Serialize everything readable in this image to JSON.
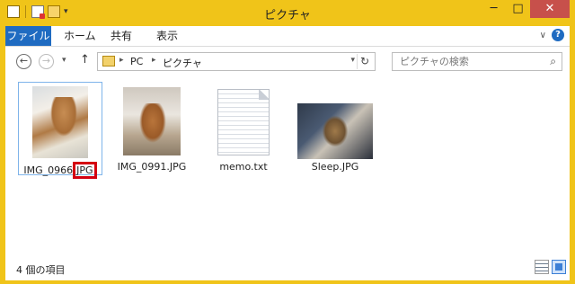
{
  "window": {
    "title": "ピクチャ",
    "controls": {
      "minimize": "─",
      "maximize": "□",
      "close": "✕"
    }
  },
  "quick_access": {
    "icons": [
      "folder-icon",
      "properties-icon",
      "new-folder-icon"
    ],
    "dropdown": "▾"
  },
  "ribbon": {
    "tabs": [
      {
        "label": "ファイル",
        "active": true
      },
      {
        "label": "ホーム"
      },
      {
        "label": "共有"
      },
      {
        "label": "表示"
      }
    ],
    "expand": "∨",
    "help": "?"
  },
  "navigation": {
    "back": "←",
    "forward": "→",
    "recent": "▾",
    "up": "↑",
    "breadcrumb": [
      "PC",
      "ピクチャ"
    ],
    "separator": "▸",
    "address_dropdown": "▾",
    "refresh": "↻",
    "search_placeholder": "ピクチャの検索",
    "search_icon": "⌕"
  },
  "files": [
    {
      "name_part1": "IMG_0966",
      "name_part2": "JPG",
      "type": "image",
      "selected": true,
      "highlighted_extension": true
    },
    {
      "name": "IMG_0991.JPG",
      "type": "image"
    },
    {
      "name": "memo.txt",
      "type": "text"
    },
    {
      "name": "Sleep.JPG",
      "type": "image"
    }
  ],
  "status": {
    "item_count": "4 個の項目"
  },
  "colors": {
    "title_bar": "#f0c419",
    "file_tab": "#1f6bc1",
    "selection_border": "#7eb4ea",
    "highlight_box": "#d40010"
  }
}
